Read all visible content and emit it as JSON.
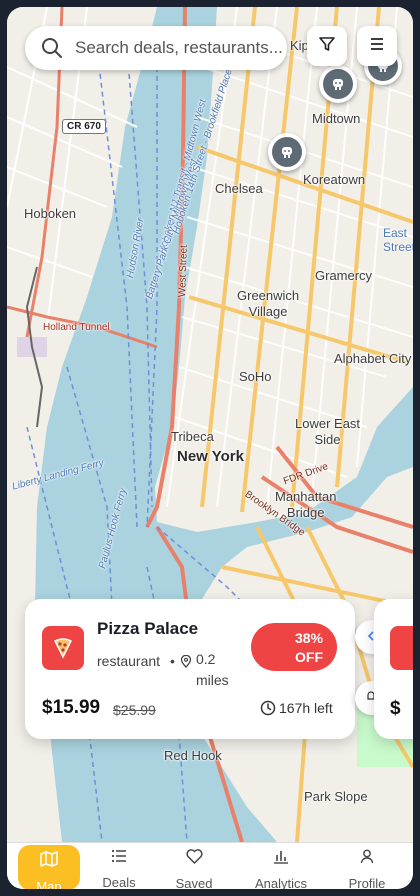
{
  "search": {
    "placeholder": "Search deals, restaurants..."
  },
  "map": {
    "labels": {
      "midtown": "Midtown",
      "koreatown": "Koreatown",
      "chelsea": "Chelsea",
      "hoboken": "Hoboken",
      "gramercy": "Gramercy",
      "greenwich_village": "Greenwich\nVillage",
      "alphabet_city": "Alphabet City",
      "soho": "SoHo",
      "lower_east_side": "Lower East\nSide",
      "tribeca": "Tribeca",
      "new_york": "New York",
      "manhattan_bridge": "Manhattan\nBridge",
      "red_hook": "Red Hook",
      "park_slope": "Park Slope",
      "kips": "Kip",
      "east": "East",
      "street": "Street",
      "route_cr670": "CR 670",
      "west_street": "West Street",
      "holland_tunnel": "Holland Tunnel",
      "fdr_drive": "FDR Drive",
      "brooklyn_bridge": "Brooklyn Bridge",
      "ferry_1": "Hoboken NJ Transit - Midtown West",
      "ferry_2": "Battery Park City - Midtown West",
      "ferry_3": "Hoboken 14th Street - Brookfield Place",
      "hudson_river": "Hudson River",
      "liberty_landing": "Liberty Landing Ferry",
      "paulus_hook": "Paulus Hook Ferry"
    }
  },
  "deal_card": {
    "name": "Pizza Palace",
    "category": "restaurant",
    "separator": "•",
    "distance": "0.2 miles",
    "discount_line1": "38%",
    "discount_line2": "OFF",
    "price": "$15.99",
    "original_price": "$25.99",
    "time_left": "167h left"
  },
  "next_card": {
    "price_partial": "$"
  },
  "nav": {
    "map": "Map",
    "deals": "Deals",
    "saved": "Saved",
    "analytics": "Analytics",
    "profile": "Profile"
  },
  "colors": {
    "accent": "#fbbf24",
    "deal_red": "#ef4444",
    "pin_gray": "#5e6b74"
  },
  "icons": [
    "search-icon",
    "filter-icon",
    "menu-icon",
    "restaurant-pin-icon",
    "pizza-icon",
    "location-pin-icon",
    "clock-icon",
    "map-icon",
    "list-icon",
    "heart-icon",
    "bar-chart-icon",
    "user-icon"
  ]
}
